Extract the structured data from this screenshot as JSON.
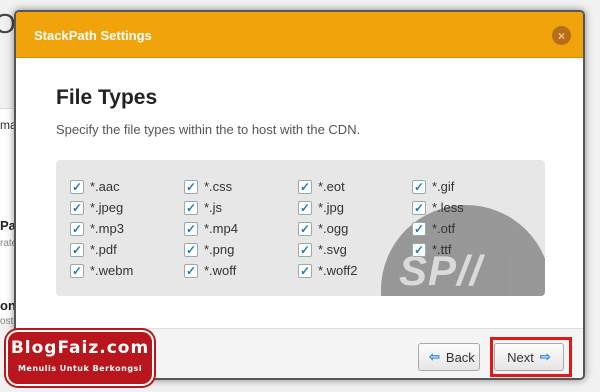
{
  "background": {
    "title_fragment": "Opti",
    "left_labels": [
      "mag",
      "Pat",
      "rate",
      "on",
      "ost De"
    ]
  },
  "modal": {
    "title": "StackPath Settings",
    "close_symbol": "×",
    "section_title": "File Types",
    "section_desc": "Specify the file types within the to host with the CDN.",
    "watermark": "SP//",
    "file_types": [
      {
        "label": "*.aac",
        "checked": true
      },
      {
        "label": "*.css",
        "checked": true
      },
      {
        "label": "*.eot",
        "checked": true
      },
      {
        "label": "*.gif",
        "checked": true
      },
      {
        "label": "*.jpeg",
        "checked": true
      },
      {
        "label": "*.js",
        "checked": true
      },
      {
        "label": "*.jpg",
        "checked": true
      },
      {
        "label": "*.less",
        "checked": true
      },
      {
        "label": "*.mp3",
        "checked": true
      },
      {
        "label": "*.mp4",
        "checked": true
      },
      {
        "label": "*.ogg",
        "checked": true
      },
      {
        "label": "*.otf",
        "checked": true
      },
      {
        "label": "*.pdf",
        "checked": true
      },
      {
        "label": "*.png",
        "checked": true
      },
      {
        "label": "*.svg",
        "checked": true
      },
      {
        "label": "*.ttf",
        "checked": true
      },
      {
        "label": "*.webm",
        "checked": true
      },
      {
        "label": "*.woff",
        "checked": true
      },
      {
        "label": "*.woff2",
        "checked": true
      }
    ],
    "buttons": {
      "back_label": "Back",
      "back_icon": "arrow-left-icon",
      "next_label": "Next",
      "next_icon": "arrow-right-icon"
    }
  },
  "logo": {
    "name": "BlogFaiz.com",
    "tagline": "Menulis Untuk Berkongsi"
  },
  "colors": {
    "header": "#f0a30a",
    "highlight": "#e01818",
    "logo_bg": "#b8161c",
    "check": "#1e7fb8"
  }
}
